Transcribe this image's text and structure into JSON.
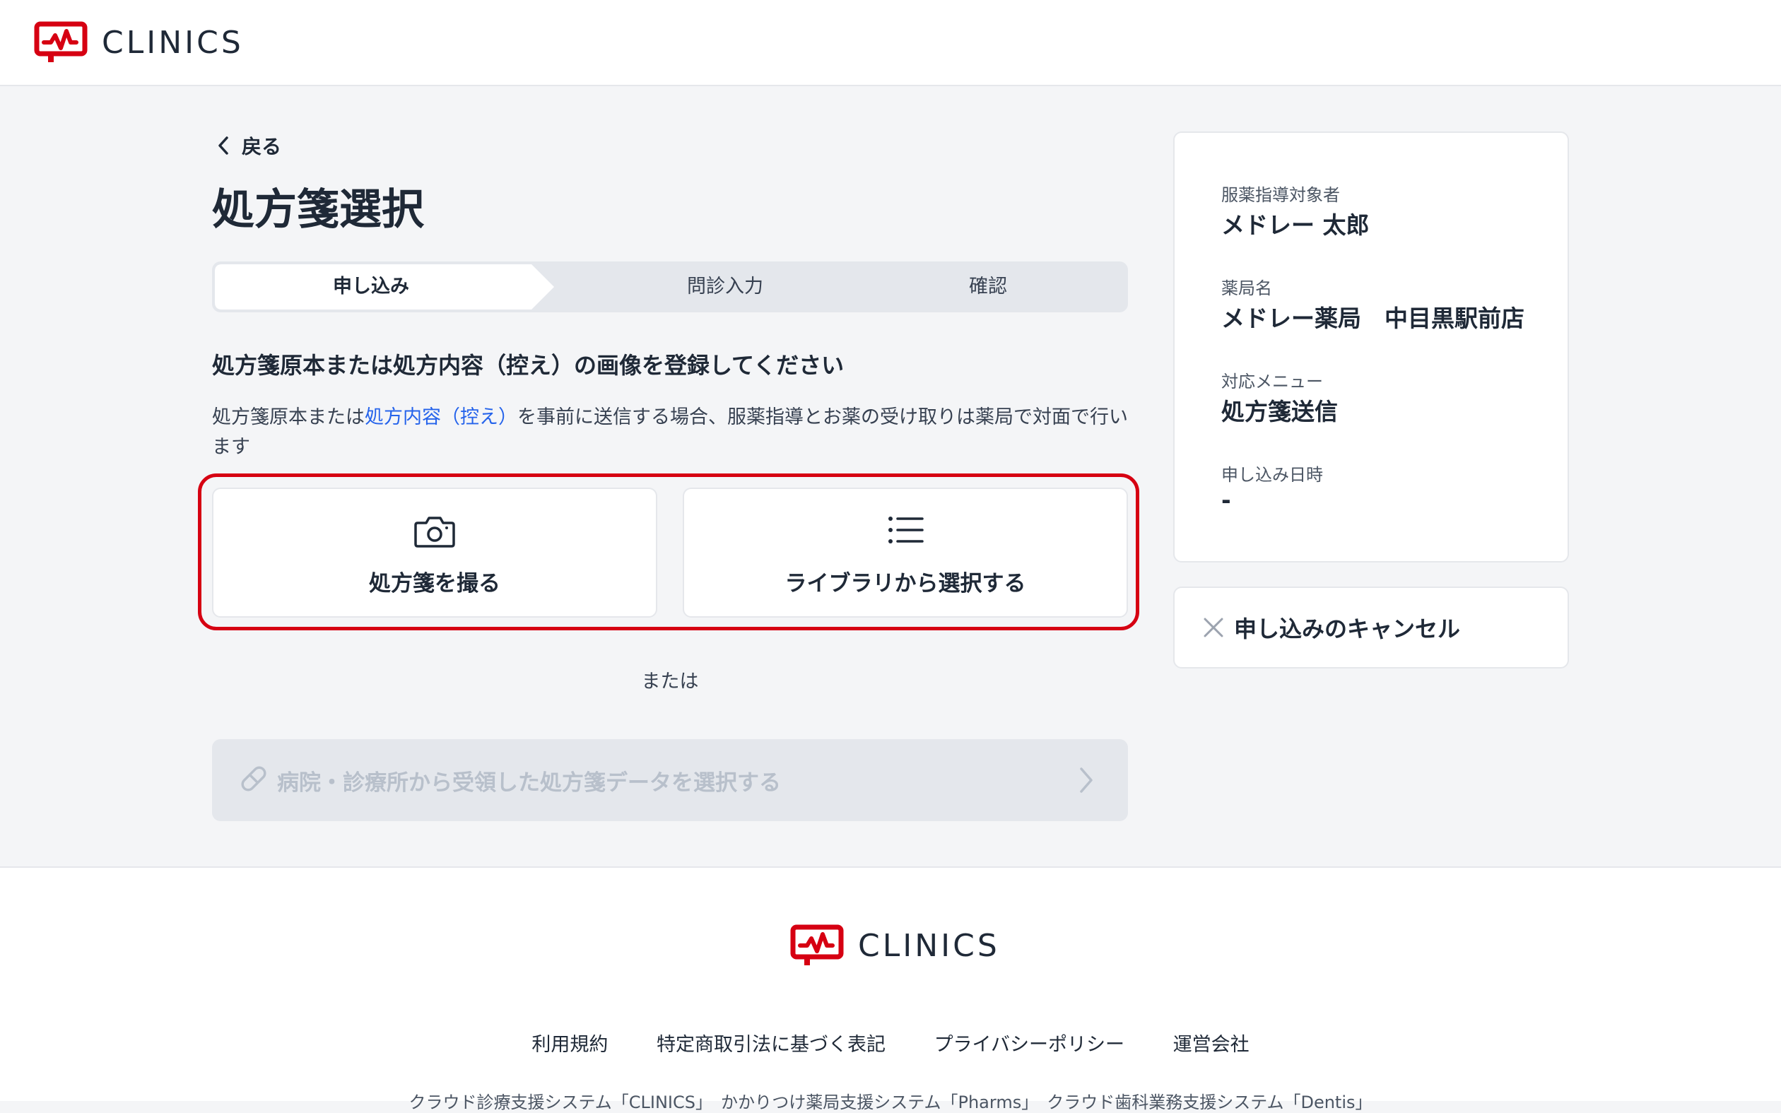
{
  "header": {
    "logo_text": "CLINICS"
  },
  "nav": {
    "back_label": "戻る"
  },
  "page_title": "処方箋選択",
  "steps": [
    {
      "label": "申し込み",
      "active": true
    },
    {
      "label": "問診入力",
      "active": false
    },
    {
      "label": "確認",
      "active": false
    }
  ],
  "instructions": {
    "title": "処方箋原本または処方内容（控え）の画像を登録してください",
    "desc_before": "処方箋原本または",
    "desc_link": "処方内容（控え）",
    "desc_after": "を事前に送信する場合、服薬指導とお薬の受け取りは薬局で対面で行います"
  },
  "options": {
    "take_photo_label": "処方箋を撮る",
    "library_label": "ライブラリから選択する"
  },
  "or_text": "または",
  "hospital_select_label": "病院・診療所から受領した処方箋データを選択する",
  "info": {
    "patient_label": "服薬指導対象者",
    "patient_value": "メドレー 太郎",
    "pharmacy_label": "薬局名",
    "pharmacy_value": "メドレー薬局　中目黒駅前店",
    "menu_label": "対応メニュー",
    "menu_value": "処方箋送信",
    "date_label": "申し込み日時",
    "date_value": "-"
  },
  "cancel_label": "申し込みのキャンセル",
  "footer": {
    "logo_text": "CLINICS",
    "links": [
      "利用規約",
      "特定商取引法に基づく表記",
      "プライバシーポリシー",
      "運営会社"
    ],
    "note": "クラウド診療支援システム「CLINICS」　かかりつけ薬局支援システム「Pharms」　クラウド歯科業務支援システム「Dentis」"
  },
  "colors": {
    "brand_red": "#d60012",
    "link_blue": "#2563eb",
    "background": "#f4f5f7",
    "disabled_text": "#b8c0cb"
  }
}
